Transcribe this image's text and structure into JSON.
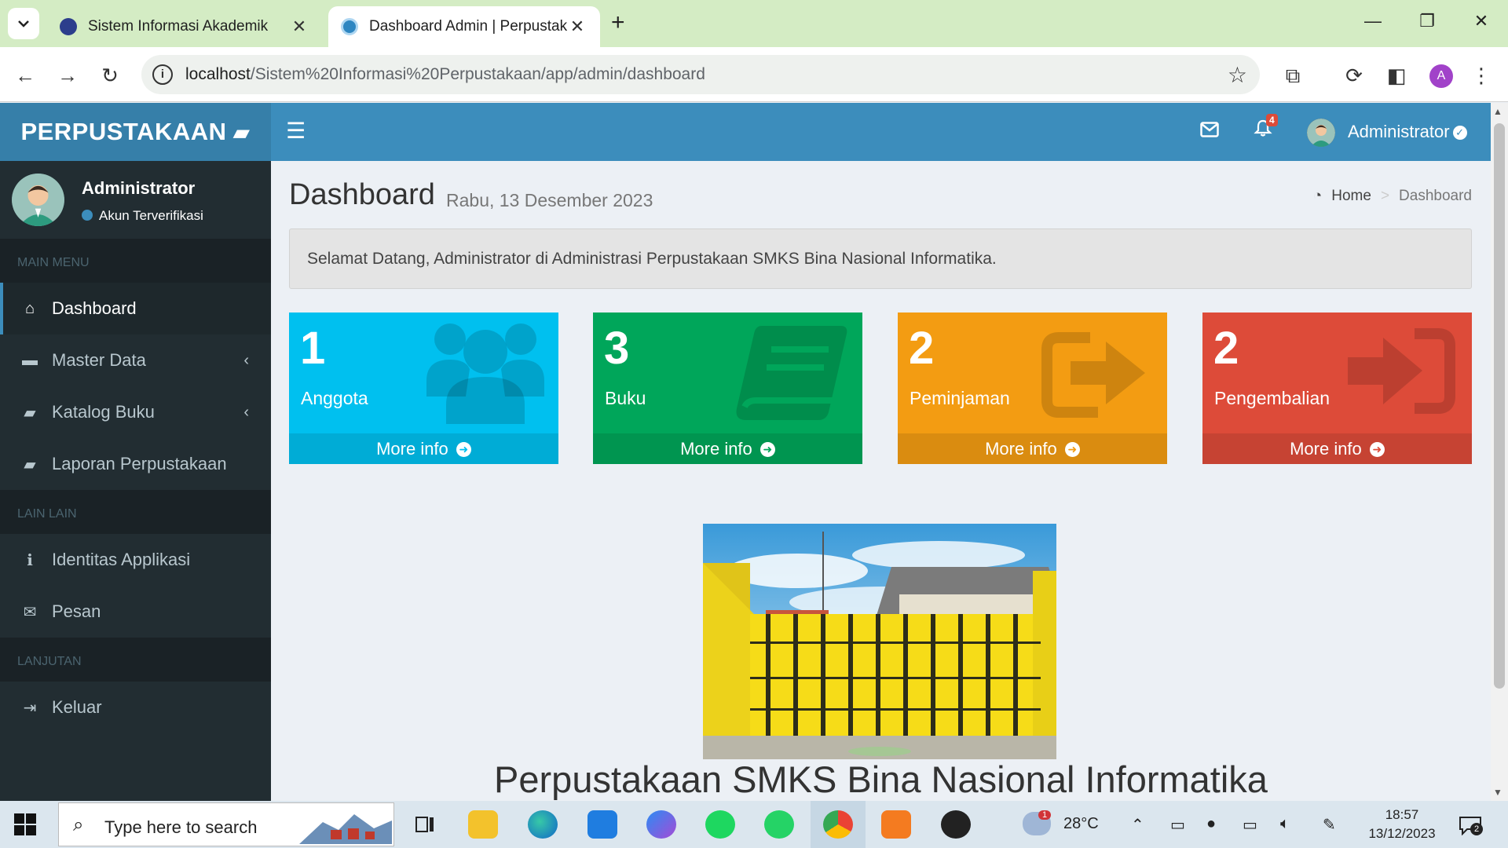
{
  "browser": {
    "tabs": [
      {
        "title": "Sistem Informasi Akademik",
        "active": false
      },
      {
        "title": "Dashboard Admin | Perpustaka",
        "active": true
      }
    ],
    "url_host": "localhost",
    "url_path": "/Sistem%20Informasi%20Perpustakaan/app/admin/dashboard",
    "profile_initial": "A"
  },
  "navbar": {
    "brand": "PERPUSTAKAAN",
    "notification_count": "4",
    "user_name": "Administrator"
  },
  "sidebar": {
    "user": {
      "name": "Administrator",
      "status": "Akun Terverifikasi"
    },
    "headers": [
      "MAIN MENU",
      "LAIN LAIN",
      "LANJUTAN"
    ],
    "items": [
      {
        "label": "Dashboard",
        "icon": "home-icon",
        "active": true
      },
      {
        "label": "Master Data",
        "icon": "folder-icon",
        "has_submenu": true
      },
      {
        "label": "Katalog Buku",
        "icon": "book-icon",
        "has_submenu": true
      },
      {
        "label": "Laporan Perpustakaan",
        "icon": "book-icon"
      },
      {
        "label": "Identitas Applikasi",
        "icon": "info-icon"
      },
      {
        "label": "Pesan",
        "icon": "envelope-icon"
      },
      {
        "label": "Keluar",
        "icon": "sign-out-icon"
      }
    ]
  },
  "content": {
    "title": "Dashboard",
    "subtitle": "Rabu, 13 Desember 2023",
    "breadcrumb": {
      "home": "Home",
      "current": "Dashboard"
    },
    "welcome": "Selamat Datang, Administrator di Administrasi Perpustakaan SMKS Bina Nasional Informatika.",
    "boxes": [
      {
        "value": "1",
        "label": "Anggota",
        "footer": "More info",
        "color": "#00c0ef",
        "icon": "users-icon"
      },
      {
        "value": "3",
        "label": "Buku",
        "footer": "More info",
        "color": "#00a65a",
        "icon": "book-icon"
      },
      {
        "value": "2",
        "label": "Peminjaman",
        "footer": "More info",
        "color": "#f39c12",
        "icon": "share-icon"
      },
      {
        "value": "2",
        "label": "Pengembalian",
        "footer": "More info",
        "color": "#dd4b39",
        "icon": "sign-in-icon"
      }
    ],
    "caption": "Perpustakaan SMKS Bina Nasional Informatika"
  },
  "taskbar": {
    "search_placeholder": "Type here to search",
    "weather_badge": "1",
    "temperature": "28°C",
    "time": "18:57",
    "date": "13/12/2023",
    "notification_count": "2"
  },
  "colors": {
    "navbar": "#3c8dbc",
    "brand": "#367fa9",
    "sidebar": "#222d32"
  }
}
